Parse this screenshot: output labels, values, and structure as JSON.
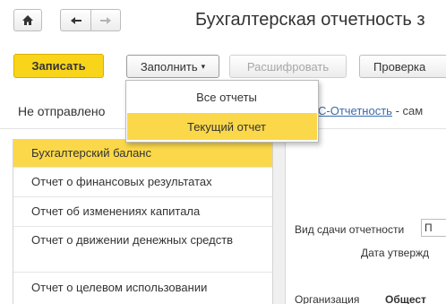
{
  "nav": {
    "home_icon": "home-icon",
    "back_icon": "arrow-left-icon",
    "forward_icon": "arrow-right-icon"
  },
  "title": "Бухгалтерская отчетность з",
  "toolbar": {
    "save_label": "Записать",
    "fill_label": "Заполнить",
    "decode_label": "Расшифровать",
    "check_label": "Проверка"
  },
  "fill_menu": {
    "items": [
      {
        "label": "Все отчеты"
      },
      {
        "label": "Текущий отчет"
      }
    ]
  },
  "status": {
    "text": "Не отправлено",
    "link_label": "С-Отчетность",
    "link_suffix": " - сам"
  },
  "reports": {
    "items": [
      {
        "label": "Бухгалтерский баланс"
      },
      {
        "label": "Отчет о финансовых результатах"
      },
      {
        "label": "Отчет об изменениях капитала"
      },
      {
        "label": "Отчет о движении денежных средств"
      },
      {
        "label": "Отчет о целевом использовании"
      }
    ]
  },
  "form": {
    "submission_type_label": "Вид сдачи отчетности",
    "submission_type_value": "П",
    "approval_date_label": "Дата утвержд",
    "organization_label": "Организация",
    "organization_value": "Общест"
  },
  "colors": {
    "accent_yellow": "#f8d51a",
    "selection_yellow": "#fbd84a",
    "link_blue": "#3a6aa9"
  }
}
